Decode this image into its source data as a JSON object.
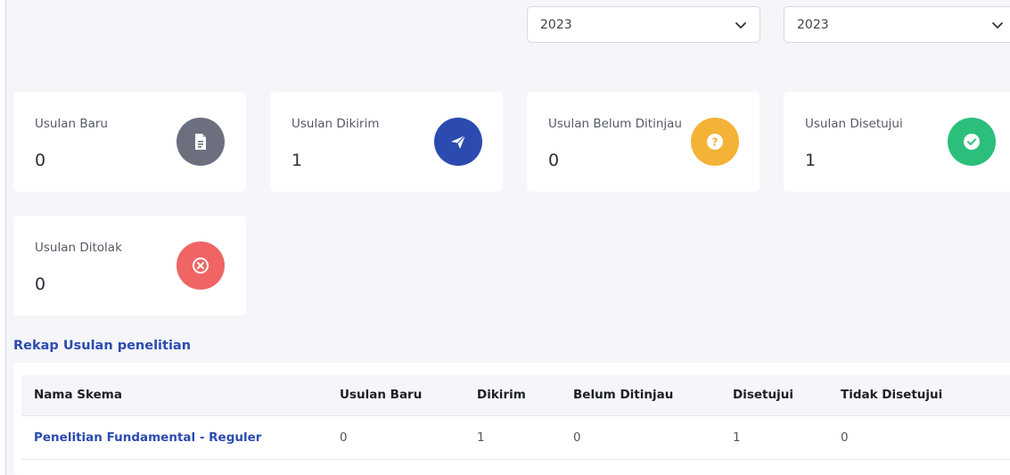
{
  "filters": {
    "year_from": "2023",
    "year_to": "2023"
  },
  "stats": {
    "baru": {
      "label": "Usulan Baru",
      "value": "0",
      "color": "#6c6f7e",
      "icon": "document-icon"
    },
    "dikirim": {
      "label": "Usulan Dikirim",
      "value": "1",
      "color": "#2c4bb0",
      "icon": "paper-plane-icon"
    },
    "belum": {
      "label": "Usulan Belum Ditinjau",
      "value": "0",
      "color": "#f4b237",
      "icon": "question-icon"
    },
    "disetujui": {
      "label": "Usulan Disetujui",
      "value": "1",
      "color": "#2bbf7b",
      "icon": "check-circle-icon"
    },
    "ditolak": {
      "label": "Usulan Ditolak",
      "value": "0",
      "color": "#f06464",
      "icon": "x-circle-icon"
    }
  },
  "rekap": {
    "title": "Rekap Usulan penelitian",
    "headers": [
      "Nama Skema",
      "Usulan Baru",
      "Dikirim",
      "Belum Ditinjau",
      "Disetujui",
      "Tidak Disetujui"
    ],
    "rows": [
      [
        "Penelitian Fundamental - Reguler",
        "0",
        "1",
        "0",
        "1",
        "0"
      ]
    ]
  }
}
